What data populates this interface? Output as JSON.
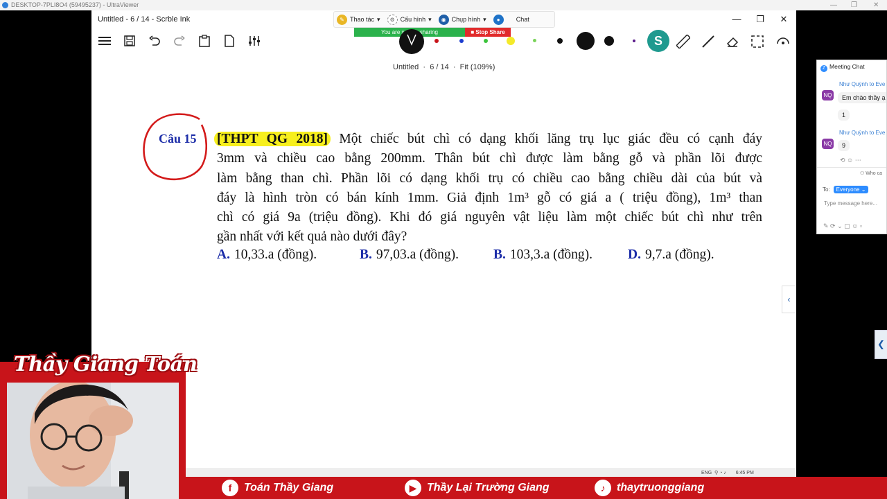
{
  "outer_window": {
    "title": "DESKTOP-7PLI8O4 (59495237) - UltraViewer"
  },
  "app_window": {
    "title": "Untitled - 6 / 14 - Scrble Ink"
  },
  "remote_toolbar": {
    "items": [
      {
        "label": "Thao tác",
        "icon": "pencil-icon"
      },
      {
        "label": "Cấu hình",
        "icon": "gear-icon"
      },
      {
        "label": "Chụp hình",
        "icon": "camera-icon"
      },
      {
        "label": "Chat",
        "icon": "chat-icon"
      }
    ],
    "sharing_text": "You are screen sharing",
    "stop_share_label": "Stop Share"
  },
  "doc_info": {
    "name": "Untitled",
    "page": "6 / 14",
    "zoom": "Fit (109%)"
  },
  "pen_colors": [
    "#c8141a",
    "#1b3ccf",
    "#3cc43c",
    "#f4ea2a",
    "#7ad35a"
  ],
  "question": {
    "label": "Câu 15",
    "source": "[THPT QG 2018]",
    "lines": [
      "Một chiếc bút chì có dạng khối lăng trụ lục giác đều có cạnh đáy",
      "3mm và chiều cao bằng 200mm. Thân bút chì được làm bằng gỗ và phần lõi được",
      "làm bằng than chì. Phần lõi có dạng khối trụ có chiều cao bằng chiều dài của bút và",
      "đáy là hình tròn có bán kính 1mm. Giả định 1m³ gỗ có giá a ( triệu đồng), 1m³ than",
      "chì có giá 9a (triệu đồng). Khi đó giá nguyên vật liệu làm một chiếc bút chì như trên",
      "gần nhất với kết quả nào dưới đây?"
    ],
    "answers": [
      {
        "letter": "A.",
        "text": "10,33.a (đồng)."
      },
      {
        "letter": "B.",
        "text": "97,03.a (đồng)."
      },
      {
        "letter": "B.",
        "text": "103,3.a (đồng)."
      },
      {
        "letter": "D.",
        "text": "9,7.a (đồng)."
      }
    ]
  },
  "chat": {
    "title": "Meeting Chat",
    "messages": [
      {
        "sender": "Như Quỳnh to Eve",
        "avatar": "NQ",
        "texts": [
          "Em chào thầy ạ",
          "1"
        ]
      },
      {
        "sender": "Như Quỳnh to Eve",
        "avatar": "NQ",
        "texts": [
          "9"
        ]
      }
    ],
    "who_can": "Who ca",
    "to_label": "To:",
    "to_value": "Everyone",
    "placeholder": "Type message here..."
  },
  "webcam": {
    "title": "Thầy Giang Toán"
  },
  "social": {
    "facebook": "Toán Thầy Giang",
    "youtube": "Thầy Lại Trường Giang",
    "tiktok": "thaytruonggiang"
  },
  "tray": {
    "lang": "ENG",
    "time": "6:45 PM"
  }
}
